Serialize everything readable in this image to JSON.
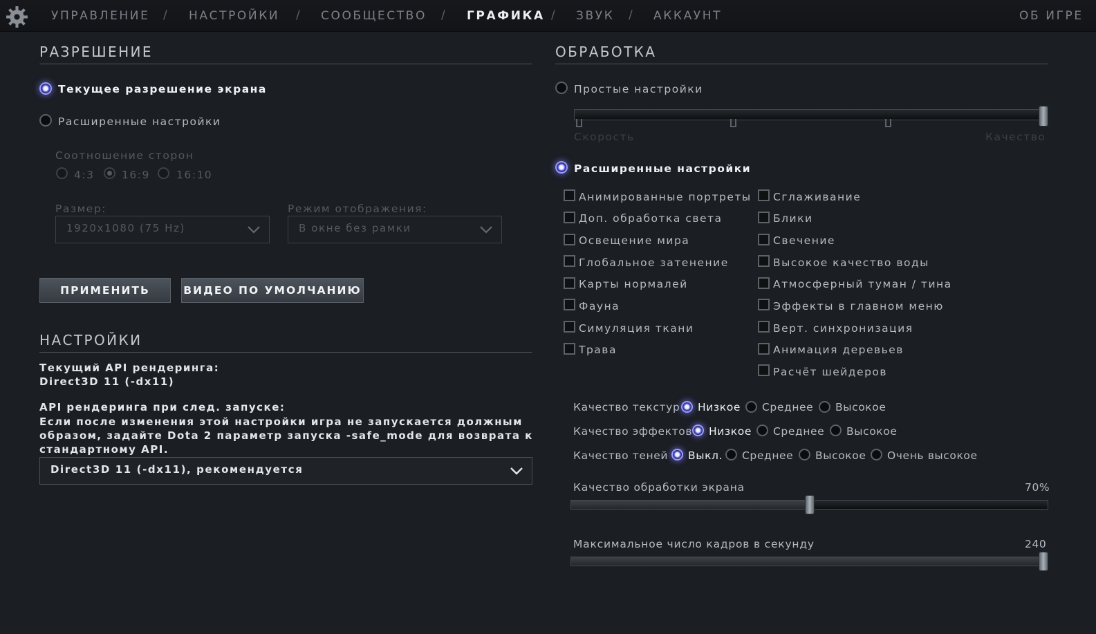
{
  "nav": {
    "items": [
      "УПРАВЛЕНИЕ",
      "НАСТРОЙКИ",
      "СООБЩЕСТВО",
      "ГРАФИКА",
      "ЗВУК",
      "АККАУНТ"
    ],
    "separator": "/",
    "active": "ГРАФИКА",
    "about": "ОБ ИГРЕ"
  },
  "resolution": {
    "title": "РАЗРЕШЕНИЕ",
    "current_label": "Текущее разрешение экрана",
    "current_selected": true,
    "advanced_label": "Расширенные настройки",
    "aspect_label": "Соотношение сторон",
    "aspect_options": [
      "4:3",
      "16:9",
      "16:10"
    ],
    "aspect_selected": "16:9",
    "size_label": "Размер:",
    "size_value": "1920x1080 (75 Hz)",
    "display_mode_label": "Режим отображения:",
    "display_mode_value": "В окне без рамки",
    "apply_button": "ПРИМЕНИТЬ",
    "default_button": "ВИДЕО ПО УМОЛЧАНИЮ"
  },
  "settings": {
    "title": "НАСТРОЙКИ",
    "current_api_label": "Текущий API рендеринга:",
    "current_api_value": "Direct3D 11 (-dx11)",
    "next_api_label": "API рендеринга при след. запуске:",
    "note_lines": [
      "Если после изменения этой настройки игра не запускается должным",
      "образом, задайте Dota 2 параметр запуска -safe_mode для возврата к",
      "стандартному API."
    ],
    "api_dropdown_value": "Direct3D 11 (-dx11), рекомендуется"
  },
  "processing": {
    "title": "ОБРАБОТКА",
    "simple_label": "Простые настройки",
    "speed_label": "Скорость",
    "quality_label": "Качество",
    "simple_slider_level": 1.0,
    "advanced_label": "Расширенные настройки",
    "advanced_selected": true,
    "checkboxes_left": [
      "Анимированные портреты",
      "Доп. обработка света",
      "Освещение мира",
      "Глобальное затенение",
      "Карты нормалей",
      "Фауна",
      "Симуляция ткани",
      "Трава"
    ],
    "checkboxes_right": [
      "Сглаживание",
      "Блики",
      "Свечение",
      "Высокое качество воды",
      "Атмосферный туман / тина",
      "Эффекты в главном меню",
      "Верт. синхронизация",
      "Анимация деревьев",
      "Расчёт шейдеров"
    ],
    "texture_quality": {
      "label": "Качество текстур",
      "options": [
        "Низкое",
        "Среднее",
        "Высокое"
      ],
      "selected": "Низкое"
    },
    "effects_quality": {
      "label": "Качество эффектов",
      "options": [
        "Низкое",
        "Среднее",
        "Высокое"
      ],
      "selected": "Низкое"
    },
    "shadow_quality": {
      "label": "Качество теней",
      "options": [
        "Выкл.",
        "Среднее",
        "Высокое",
        "Очень высокое"
      ],
      "selected": "Выкл."
    },
    "screen_quality": {
      "label": "Качество обработки экрана",
      "value_text": "70%",
      "level": 0.5
    },
    "max_fps": {
      "label": "Максимальное число кадров в секунду",
      "value_text": "240",
      "level": 1.0
    }
  },
  "colors": {
    "background": "#1b1e23",
    "accent_radio": "#9aa0ff"
  }
}
